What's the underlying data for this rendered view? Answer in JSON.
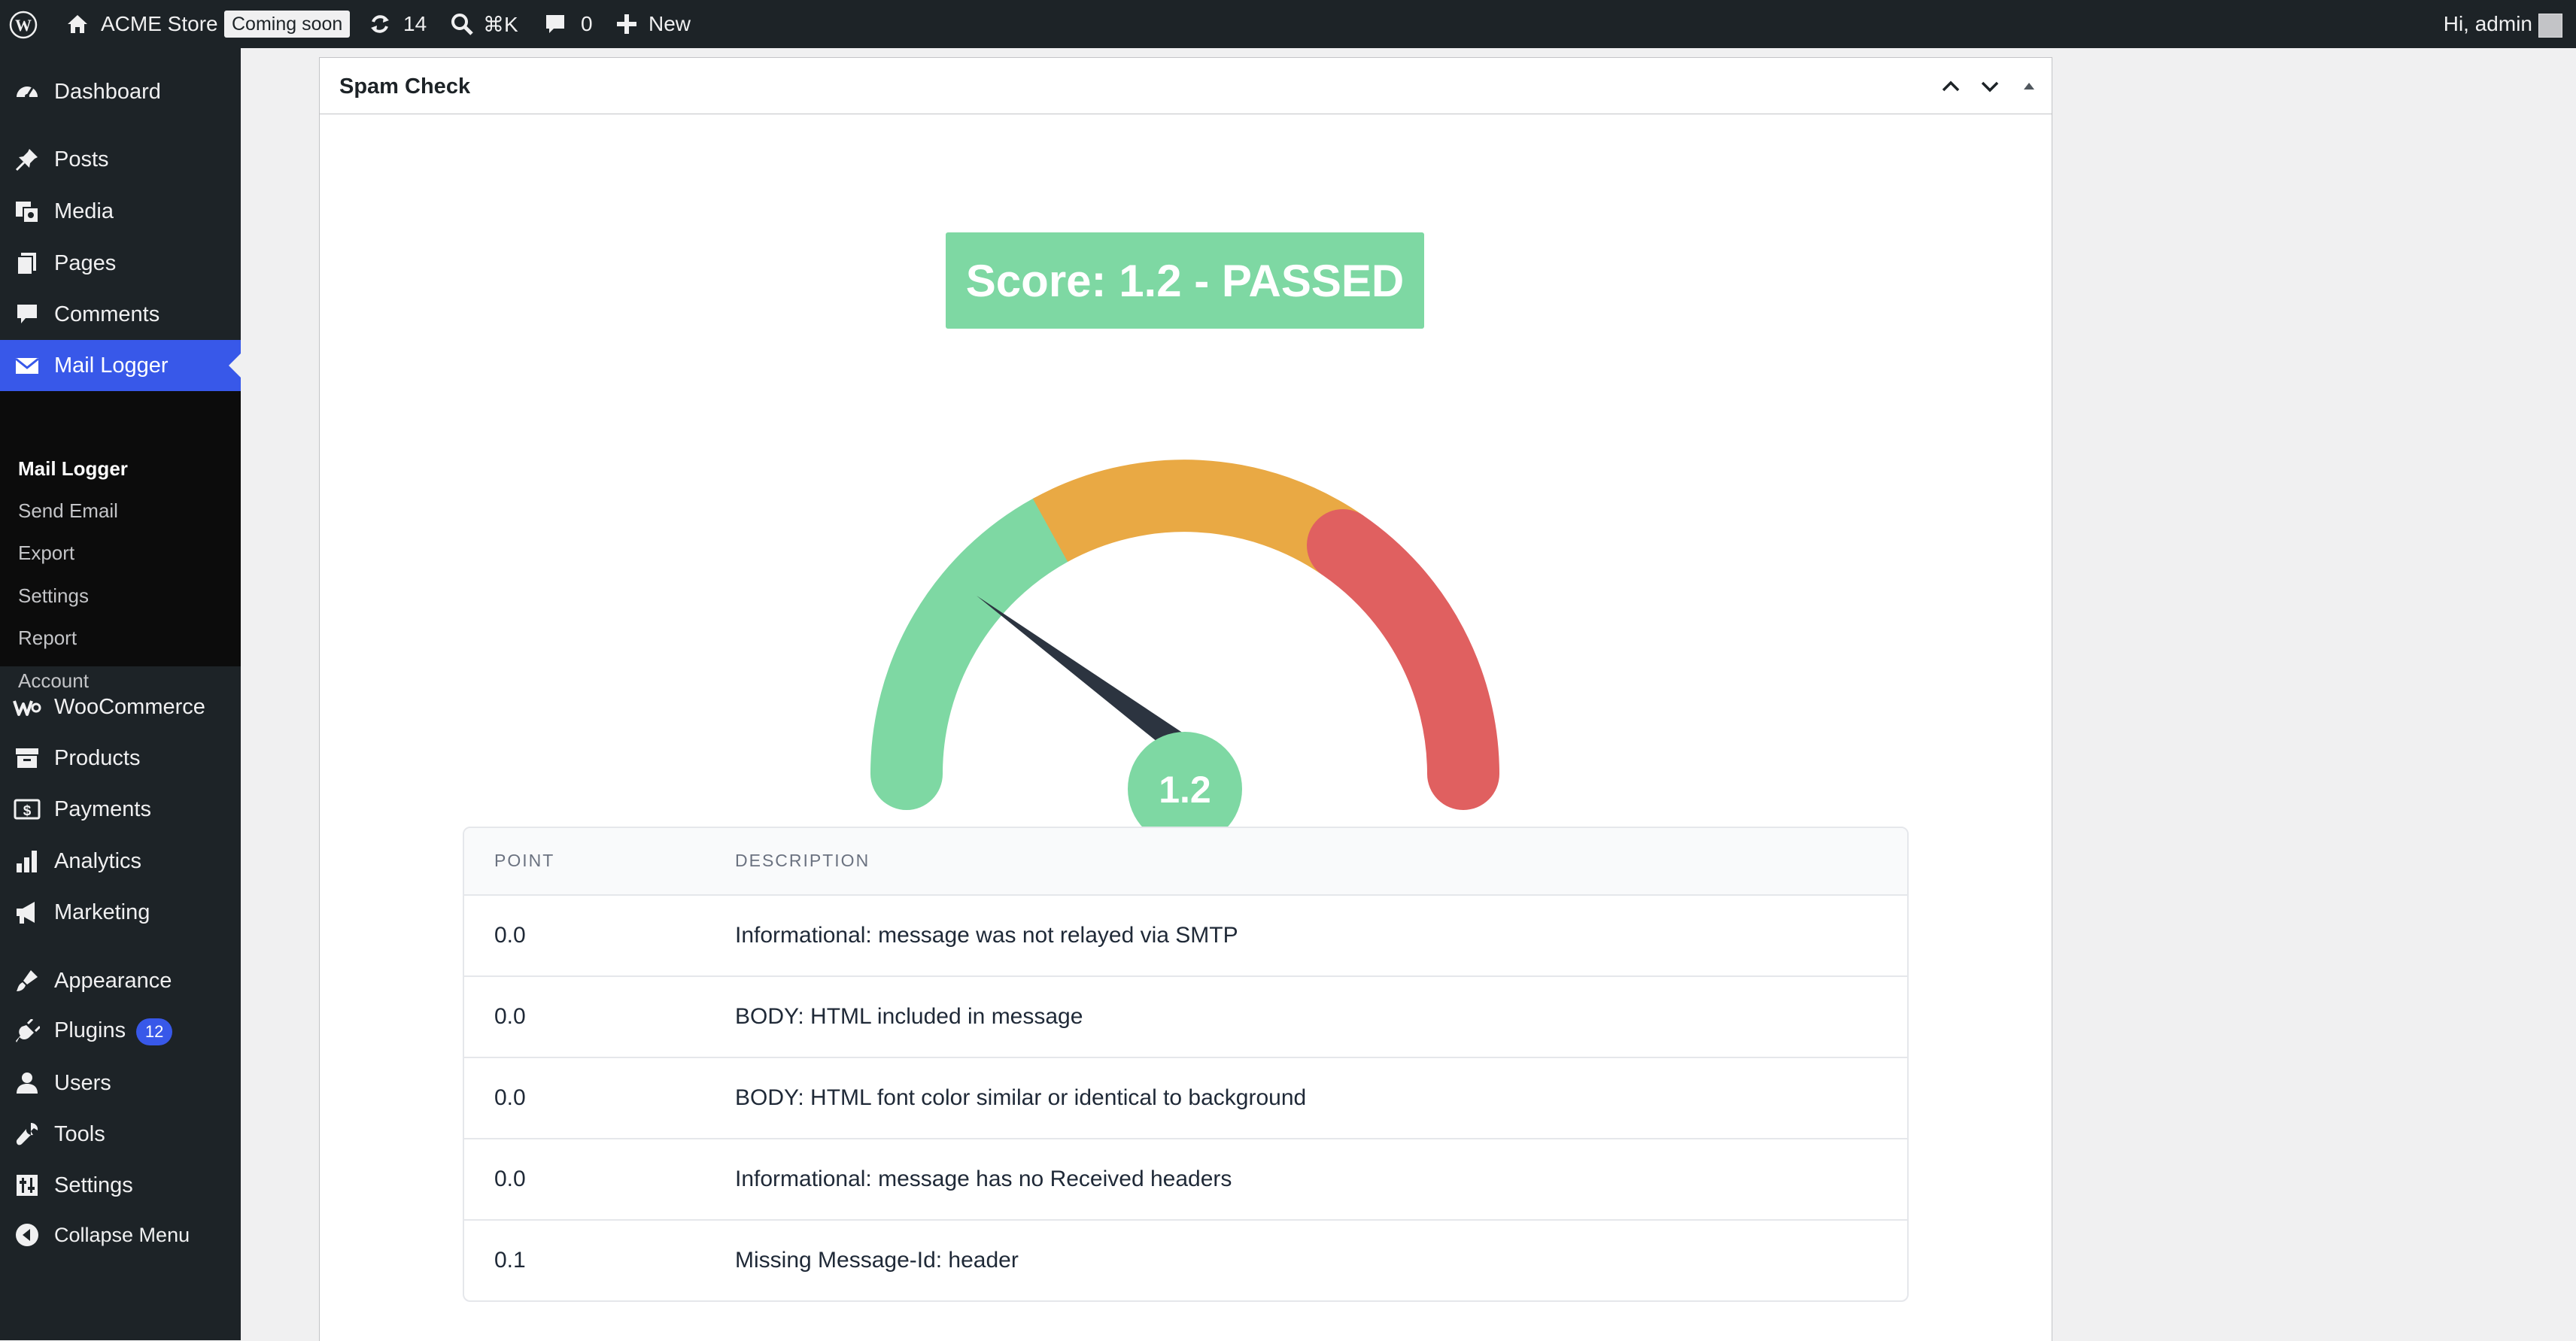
{
  "adminbar": {
    "site_name": "ACME Store",
    "coming_soon": "Coming soon",
    "updates_count": "14",
    "search_shortcut": "⌘K",
    "comments_count": "0",
    "new_label": "New",
    "howdy": "Hi, admin"
  },
  "sidebar": {
    "items": [
      {
        "label": "Dashboard",
        "icon": "dashboard-icon"
      },
      {
        "label": "Posts",
        "icon": "pin-icon"
      },
      {
        "label": "Media",
        "icon": "media-icon"
      },
      {
        "label": "Pages",
        "icon": "pages-icon"
      },
      {
        "label": "Comments",
        "icon": "comment-icon"
      },
      {
        "label": "Mail Logger",
        "icon": "envelope-icon"
      },
      {
        "label": "WooCommerce",
        "icon": "woo-icon"
      },
      {
        "label": "Products",
        "icon": "archive-icon"
      },
      {
        "label": "Payments",
        "icon": "payment-icon"
      },
      {
        "label": "Analytics",
        "icon": "bar-chart-icon"
      },
      {
        "label": "Marketing",
        "icon": "megaphone-icon"
      },
      {
        "label": "Appearance",
        "icon": "paintbrush-icon"
      },
      {
        "label": "Plugins",
        "icon": "plug-icon",
        "badge": "12"
      },
      {
        "label": "Users",
        "icon": "user-icon"
      },
      {
        "label": "Tools",
        "icon": "wrench-icon"
      },
      {
        "label": "Settings",
        "icon": "sliders-icon"
      },
      {
        "label": "Collapse Menu",
        "icon": "collapse-icon"
      }
    ],
    "submenu": [
      "Mail Logger",
      "Send Email",
      "Export",
      "Settings",
      "Report",
      "Account"
    ]
  },
  "panel": {
    "title": "Spam Check",
    "score_text": "Score: 1.2 - PASSED",
    "gauge_value": "1.2",
    "gauge_colors": {
      "good": "#7ed8a3",
      "warn": "#e9a944",
      "bad": "#e06060",
      "needle": "#2c3440"
    }
  },
  "table": {
    "headers": {
      "point": "POINT",
      "description": "DESCRIPTION"
    },
    "rows": [
      {
        "point": "0.0",
        "description": "Informational: message was not relayed via SMTP"
      },
      {
        "point": "0.0",
        "description": "BODY: HTML included in message"
      },
      {
        "point": "0.0",
        "description": "BODY: HTML font color similar or identical to background"
      },
      {
        "point": "0.0",
        "description": "Informational: message has no Received headers"
      },
      {
        "point": "0.1",
        "description": "Missing Message-Id: header"
      }
    ]
  }
}
